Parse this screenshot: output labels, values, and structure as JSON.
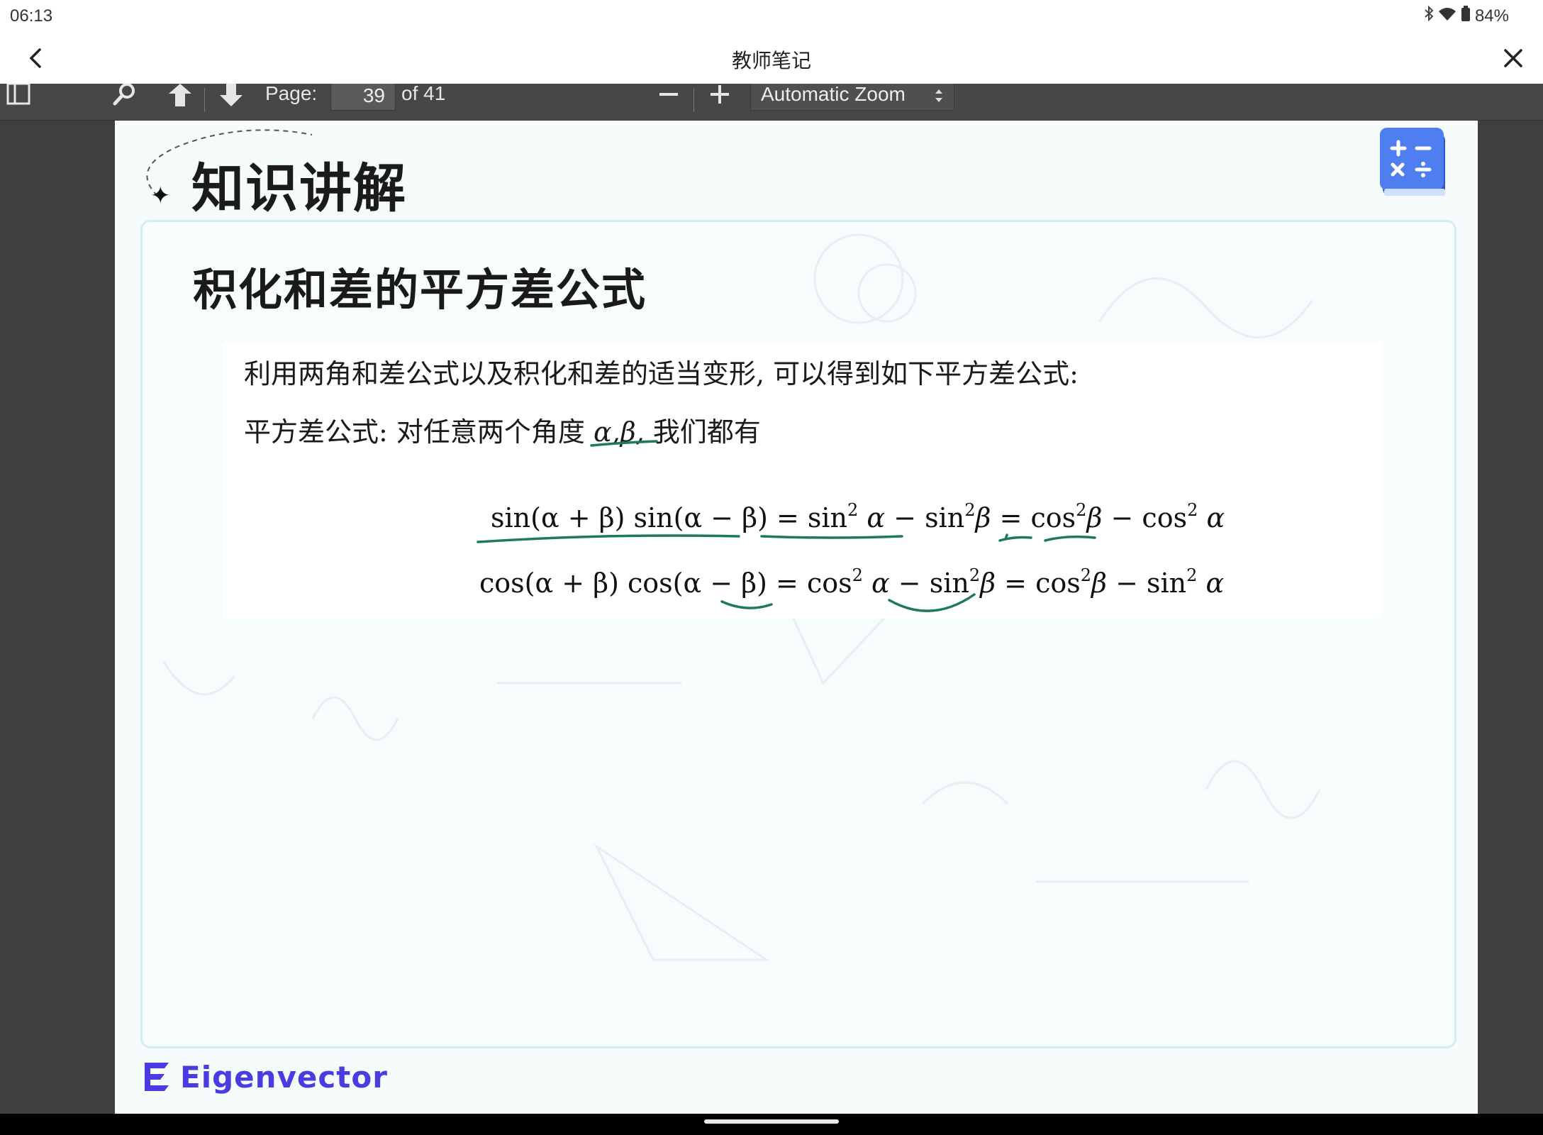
{
  "status_bar": {
    "time": "06:13",
    "battery": "84%",
    "icons": [
      "bluetooth-icon",
      "wifi-icon",
      "battery-icon"
    ]
  },
  "app_bar": {
    "title": "教师笔记",
    "back_icon": "chevron-left-icon",
    "close_icon": "close-icon"
  },
  "pdf_toolbar": {
    "page_label": "Page:",
    "page_value": "39",
    "page_total": "of 41",
    "zoom_value": "Automatic Zoom",
    "icons": [
      "sidebar-toggle-icon",
      "search-icon",
      "page-up-icon",
      "page-down-icon",
      "zoom-out-icon",
      "zoom-in-icon"
    ]
  },
  "slide": {
    "heading": "知识讲解",
    "section_title": "积化和差的平方差公式",
    "intro": "利用两角和差公式以及积化和差的适当变形, 可以得到如下平方差公式:",
    "statement_prefix": "平方差公式: 对任意两个角度 ",
    "statement_vars": "α,β,",
    "statement_suffix": " 我们都有",
    "formula1": {
      "lhs": "sin(α + β) sin(α − β)",
      "eq": " = ",
      "t1_fn": "sin",
      "t1_var": "α",
      "minus1": " − ",
      "t2_fn": "sin",
      "t2_var": "β",
      "eq2": " = ",
      "t3_fn": "cos",
      "t3_var": "β",
      "minus2": " − ",
      "t4_fn": "cos",
      "t4_var": "α",
      "exp": "2"
    },
    "formula2": {
      "lhs": "cos(α + β) cos(α − β)",
      "eq": " = ",
      "t1_fn": "cos",
      "t1_var": "α",
      "minus1": " − ",
      "t2_fn": "sin",
      "t2_var": "β",
      "eq2": " = ",
      "t3_fn": "cos",
      "t3_var": "β",
      "minus2": " − ",
      "t4_fn": "sin",
      "t4_var": "α",
      "exp": "2"
    },
    "logo_text": "Eigenvector",
    "colors": {
      "ink": "#1f7a55",
      "logo": "#4a3ce0",
      "page_bg": "#f6fbfc",
      "toolbar_bg": "#474747"
    }
  }
}
